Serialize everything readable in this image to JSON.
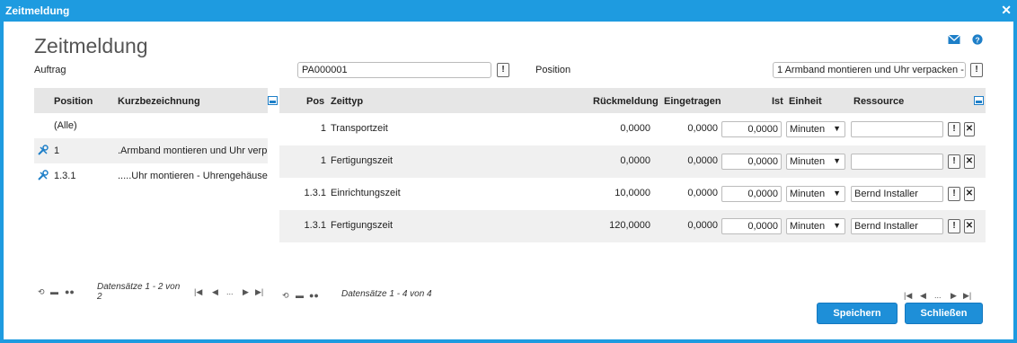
{
  "window": {
    "title": "Zeitmeldung",
    "close_icon": "close-icon"
  },
  "heading": "Zeitmeldung",
  "form": {
    "auftrag_label": "Auftrag",
    "auftrag_value": "PA000001",
    "position_label": "Position",
    "position_value": "1 Armband montieren und Uhr verpacken -"
  },
  "left_grid": {
    "columns": [
      "Position",
      "Kurzbezeichnung"
    ],
    "rows": [
      {
        "position": "(Alle)",
        "kurz": ""
      },
      {
        "position": "1",
        "kurz": ".Armband montieren und Uhr verp"
      },
      {
        "position": "1.3.1",
        "kurz": ".....Uhr montieren - Uhrengehäuse"
      }
    ],
    "pager_text": "Datensätze 1 - 2 von 2",
    "pager_nav": [
      "|◀",
      "◀",
      "...",
      "▶",
      "▶|"
    ]
  },
  "right_grid": {
    "columns": [
      "Pos",
      "Zeittyp",
      "Rückmeldung",
      "Eingetragen",
      "Ist",
      "Einheit",
      "Ressource"
    ],
    "rows": [
      {
        "pos": "1",
        "zeittyp": "Transportzeit",
        "rueck": "0,0000",
        "eing": "0,0000",
        "ist": "0,0000",
        "einheit": "Minuten",
        "ressource": ""
      },
      {
        "pos": "1",
        "zeittyp": "Fertigungszeit",
        "rueck": "0,0000",
        "eing": "0,0000",
        "ist": "0,0000",
        "einheit": "Minuten",
        "ressource": ""
      },
      {
        "pos": "1.3.1",
        "zeittyp": "Einrichtungszeit",
        "rueck": "10,0000",
        "eing": "0,0000",
        "ist": "0,0000",
        "einheit": "Minuten",
        "ressource": "Bernd Installer"
      },
      {
        "pos": "1.3.1",
        "zeittyp": "Fertigungszeit",
        "rueck": "120,0000",
        "eing": "0,0000",
        "ist": "0,0000",
        "einheit": "Minuten",
        "ressource": "Bernd Installer"
      }
    ],
    "pager_text": "Datensätze 1 - 4 von 4",
    "pager_nav": [
      "|◀",
      "◀",
      "...",
      "▶",
      "▶|"
    ]
  },
  "buttons": {
    "save": "Speichern",
    "close": "Schließen",
    "exclaim": "!",
    "remove": "✕"
  },
  "colors": {
    "accent": "#1e9be0",
    "button": "#1e8fd8"
  }
}
